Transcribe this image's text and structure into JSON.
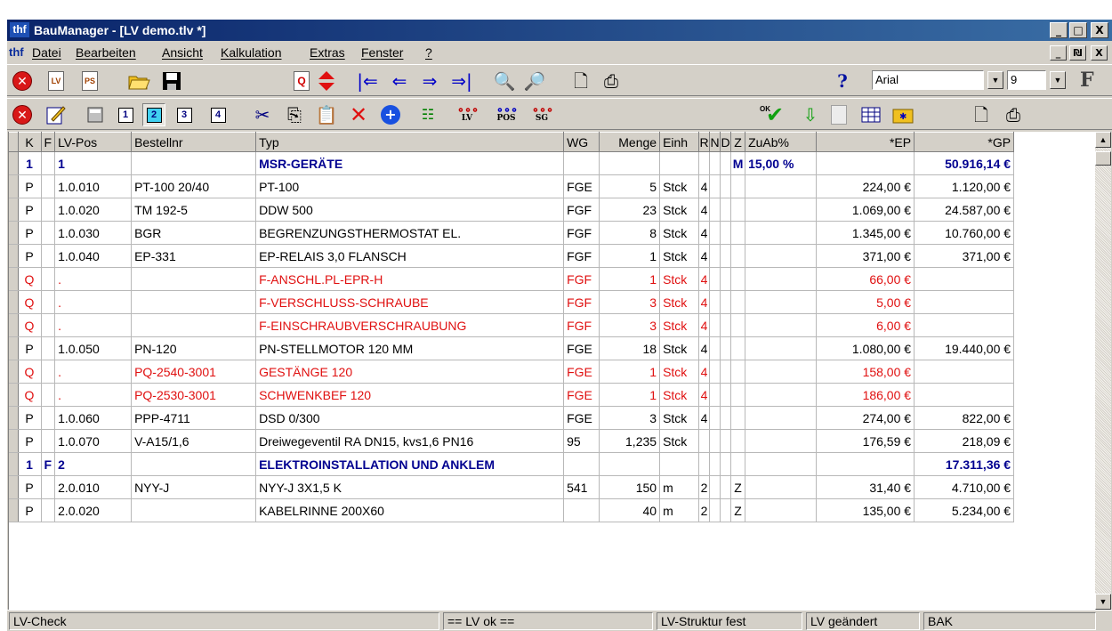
{
  "window": {
    "app_icon": "thf",
    "title": "BauManager - [LV demo.tlv *]",
    "buttons": [
      "_",
      "□",
      "X"
    ]
  },
  "menubar": {
    "logo": "thf",
    "items": [
      "Datei",
      "Bearbeiten",
      "Ansicht",
      "Kalkulation",
      "Extras",
      "Fenster",
      "?"
    ],
    "mdi_buttons": [
      "_",
      "₪",
      "X"
    ]
  },
  "toolbar1": {
    "icons": [
      "close-red-icon",
      "lv-doc-icon",
      "ps-doc-icon",
      "open-folder-icon",
      "save-disk-icon",
      "q-icon",
      "up-down-arrows-icon",
      "first-icon",
      "prev-icon",
      "next-icon",
      "last-icon",
      "find-icon",
      "find-next-icon",
      "print-preview-icon",
      "print-icon",
      "help-icon"
    ],
    "q_label": "Q",
    "lv_label": "LV",
    "ps_label": "PS",
    "font_name": "Arial",
    "font_size": "9",
    "bold_label": "F"
  },
  "toolbar2": {
    "icons": [
      "close-red-icon",
      "edit-icon",
      "calculator-icon",
      "view-1-icon",
      "view-2-icon",
      "view-3-icon",
      "view-4-icon",
      "cut-icon",
      "copy-icon",
      "paste-icon",
      "delete-icon",
      "add-icon",
      "structure-icon",
      "lv-link-icon",
      "pos-link-icon",
      "sg-link-icon",
      "ok-check-icon",
      "down-arrow-icon",
      "grey-doc-icon",
      "table-icon",
      "folder-star-icon",
      "print-preview-icon",
      "print-icon"
    ],
    "views": [
      "1",
      "2",
      "3",
      "4"
    ],
    "active_view": "2",
    "link_labels": [
      "LV",
      "POS",
      "SG"
    ],
    "ok_label": "OK"
  },
  "grid": {
    "columns": [
      "K",
      "F",
      "LV-Pos",
      "Bestellnr",
      "Typ",
      "WG",
      "Menge",
      "Einh",
      "R",
      "N",
      "D",
      "Z",
      "ZuAb%",
      "*EP",
      "*GP"
    ],
    "rows": [
      {
        "kind": "h",
        "cells": [
          "1",
          "",
          "1",
          "",
          "MSR-GERÄTE",
          "",
          "",
          "",
          "",
          "",
          "",
          "M",
          "15,00 %",
          "",
          "50.916,14 €"
        ]
      },
      {
        "kind": "p",
        "cells": [
          "P",
          "",
          "1.0.010",
          "PT-100 20/40",
          "PT-100",
          "FGE",
          "5",
          "Stck",
          "4",
          "",
          "",
          "",
          "",
          "224,00 €",
          "1.120,00 €"
        ]
      },
      {
        "kind": "p",
        "cells": [
          "P",
          "",
          "1.0.020",
          "TM 192-5",
          "DDW 500",
          "FGF",
          "23",
          "Stck",
          "4",
          "",
          "",
          "",
          "",
          "1.069,00 €",
          "24.587,00 €"
        ]
      },
      {
        "kind": "p",
        "cells": [
          "P",
          "",
          "1.0.030",
          "BGR",
          "BEGRENZUNGSTHERMOSTAT EL.",
          "FGF",
          "8",
          "Stck",
          "4",
          "",
          "",
          "",
          "",
          "1.345,00 €",
          "10.760,00 €"
        ]
      },
      {
        "kind": "p",
        "cells": [
          "P",
          "",
          "1.0.040",
          "EP-331",
          "EP-RELAIS 3,0 FLANSCH",
          "FGF",
          "1",
          "Stck",
          "4",
          "",
          "",
          "",
          "",
          "371,00 €",
          "371,00 €"
        ]
      },
      {
        "kind": "q",
        "cells": [
          "Q",
          "",
          ".",
          "",
          "F-ANSCHL.PL-EPR-H",
          "FGF",
          "1",
          "Stck",
          "4",
          "",
          "",
          "",
          "",
          "66,00 €",
          ""
        ]
      },
      {
        "kind": "q",
        "cells": [
          "Q",
          "",
          ".",
          "",
          "F-VERSCHLUSS-SCHRAUBE",
          "FGF",
          "3",
          "Stck",
          "4",
          "",
          "",
          "",
          "",
          "5,00 €",
          ""
        ]
      },
      {
        "kind": "q",
        "cells": [
          "Q",
          "",
          ".",
          "",
          "F-EINSCHRAUBVERSCHRAUBUNG",
          "FGF",
          "3",
          "Stck",
          "4",
          "",
          "",
          "",
          "",
          "6,00 €",
          ""
        ]
      },
      {
        "kind": "p",
        "cells": [
          "P",
          "",
          "1.0.050",
          "PN-120",
          "PN-STELLMOTOR 120 MM",
          "FGE",
          "18",
          "Stck",
          "4",
          "",
          "",
          "",
          "",
          "1.080,00 €",
          "19.440,00 €"
        ]
      },
      {
        "kind": "q",
        "cells": [
          "Q",
          "",
          ".",
          "PQ-2540-3001",
          "GESTÄNGE 120",
          "FGE",
          "1",
          "Stck",
          "4",
          "",
          "",
          "",
          "",
          "158,00 €",
          ""
        ]
      },
      {
        "kind": "q",
        "cells": [
          "Q",
          "",
          ".",
          "PQ-2530-3001",
          "SCHWENKBEF 120",
          "FGE",
          "1",
          "Stck",
          "4",
          "",
          "",
          "",
          "",
          "186,00 €",
          ""
        ]
      },
      {
        "kind": "p",
        "cells": [
          "P",
          "",
          "1.0.060",
          "PPP-4711",
          "DSD 0/300",
          "FGE",
          "3",
          "Stck",
          "4",
          "",
          "",
          "",
          "",
          "274,00 €",
          "822,00 €"
        ]
      },
      {
        "kind": "p",
        "cells": [
          "P",
          "",
          "1.0.070",
          "V-A15/1,6",
          "Dreiwegeventil RA  DN15, kvs1,6 PN16",
          "95",
          "1,235",
          "Stck",
          "",
          "",
          "",
          "",
          "",
          "176,59 €",
          "218,09 €"
        ]
      },
      {
        "kind": "h",
        "cells": [
          "1",
          "F",
          "2",
          "",
          "ELEKTROINSTALLATION UND ANKLEM",
          "",
          "",
          "",
          "",
          "",
          "",
          "",
          "",
          "",
          "17.311,36 €"
        ]
      },
      {
        "kind": "p",
        "cells": [
          "P",
          "",
          "2.0.010",
          "NYY-J",
          "NYY-J 3X1,5 K",
          "541",
          "150",
          "m",
          "2",
          "",
          "",
          "Z",
          "",
          "31,40 €",
          "4.710,00 €"
        ]
      },
      {
        "kind": "p",
        "cells": [
          "P",
          "",
          "2.0.020",
          "",
          "KABELRINNE 200X60",
          "",
          "40",
          "m",
          "2",
          "",
          "",
          "Z",
          "",
          "135,00 €",
          "5.234,00 €"
        ]
      }
    ]
  },
  "statusbar": {
    "panels": [
      "LV-Check",
      "== LV ok ==",
      "LV-Struktur fest",
      "LV geändert",
      "BAK"
    ]
  }
}
